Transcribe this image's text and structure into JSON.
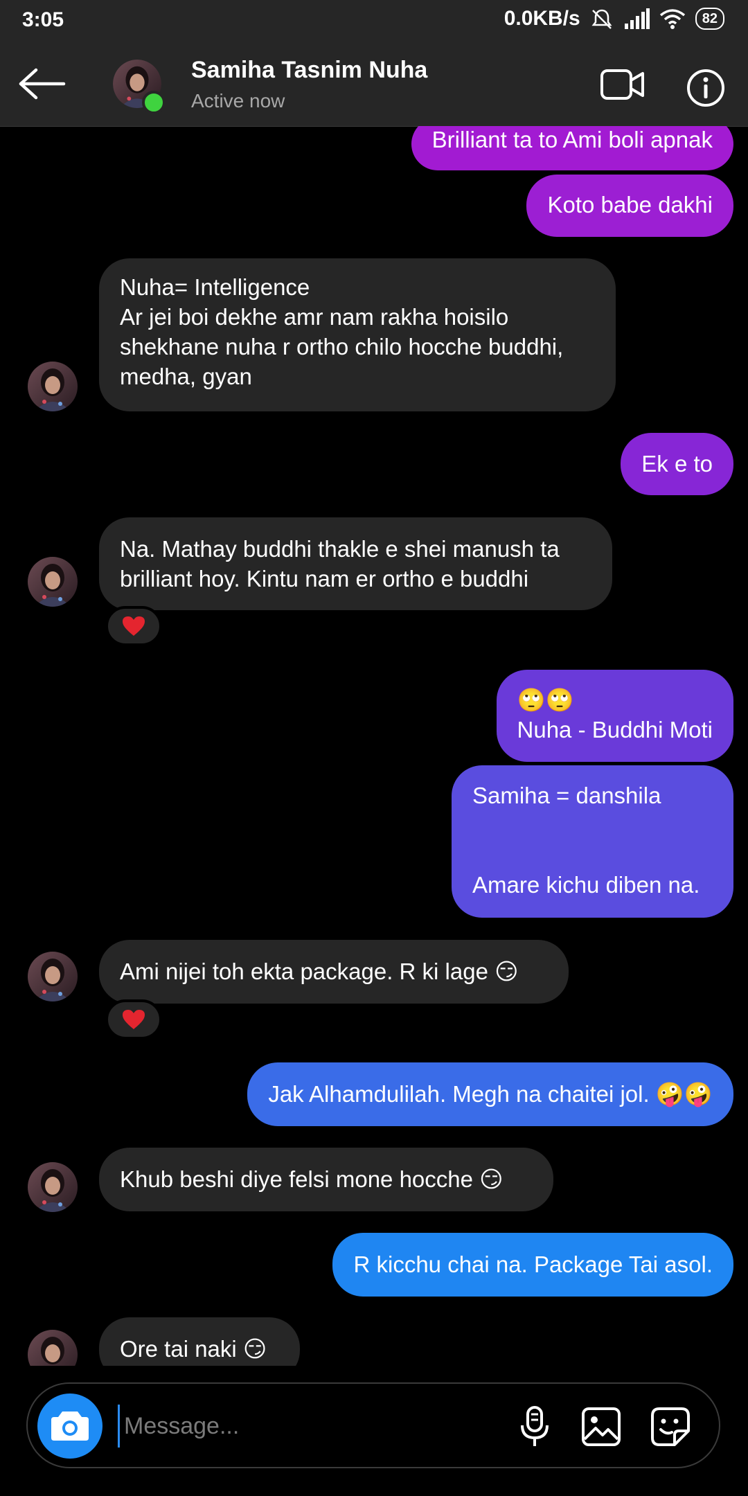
{
  "status_bar": {
    "time": "3:05",
    "network_speed": "0.0KB/s",
    "battery": "82",
    "icons": [
      "mute-icon",
      "signal-icon",
      "wifi-icon",
      "battery-icon"
    ]
  },
  "header": {
    "contact_name": "Samiha Tasnim Nuha",
    "status": "Active now",
    "icons": [
      "back-arrow-icon",
      "video-call-icon",
      "info-icon"
    ]
  },
  "messages": [
    {
      "sender": "me",
      "text": "Brilliant ta to Ami boli apnak"
    },
    {
      "sender": "me",
      "text": "Koto babe dakhi"
    },
    {
      "sender": "them",
      "text": "Nuha= Intelligence\nAr jei boi dekhe amr nam rakha hoisilo shekhane nuha r ortho chilo hocche buddhi, medha, gyan"
    },
    {
      "sender": "me",
      "text": "Ek e to"
    },
    {
      "sender": "them",
      "text": "Na. Mathay buddhi thakle e shei manush ta brilliant hoy. Kintu nam er ortho e buddhi",
      "reaction": "❤️"
    },
    {
      "sender": "me",
      "text": "🙄🙄\nNuha - Buddhi Moti"
    },
    {
      "sender": "me",
      "text": "Samiha = danshila\n\n\nAmare kichu diben na."
    },
    {
      "sender": "them",
      "text": "Ami nijei toh ekta package. R ki lage 😏",
      "reaction": "❤️"
    },
    {
      "sender": "me",
      "text": "Jak Alhamdulilah. Megh na chaitei jol. 🤪🤪"
    },
    {
      "sender": "them",
      "text": "Khub beshi diye felsi mone hocche 😏"
    },
    {
      "sender": "me",
      "text": "R kicchu chai na. Package Tai asol."
    },
    {
      "sender": "them",
      "text": "Ore tai naki 😏"
    }
  ],
  "composer": {
    "placeholder": "Message...",
    "icons": [
      "camera-icon",
      "microphone-icon",
      "gallery-icon",
      "sticker-icon"
    ]
  },
  "colors": {
    "incoming_bubble": "#262626",
    "outgoing_gradient": [
      "#a21bd2",
      "#7a2ad8",
      "#4f5ce6",
      "#1f86f2"
    ],
    "online": "#3fd33f",
    "camera_button": "#1e8cf5"
  }
}
